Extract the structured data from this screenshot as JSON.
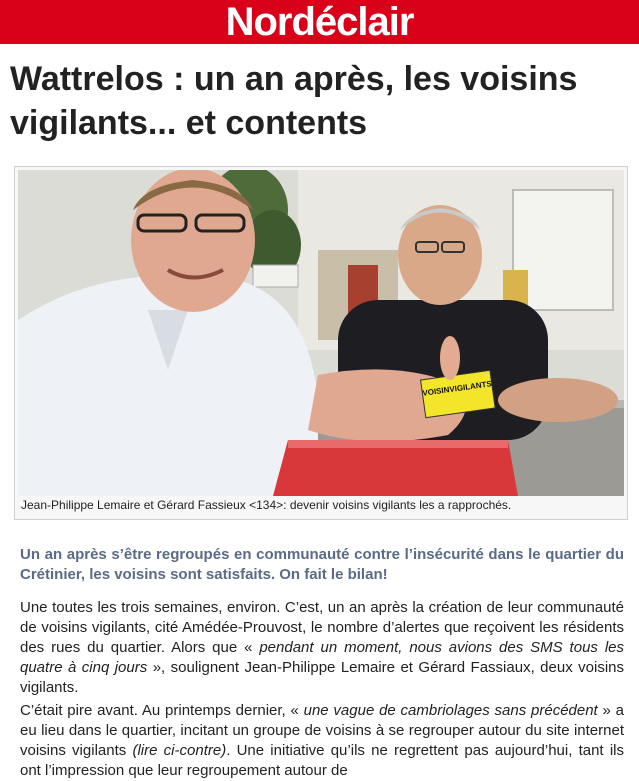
{
  "brand": {
    "logo": "Nordéclair"
  },
  "article": {
    "title": "Wattrelos : un an après, les voisins vigilants... et contents",
    "photo_caption": "Jean-Philippe Lemaire et Gérard Fassieux <134>: devenir voisins vigilants les a rapprochés.",
    "photo_card_text": "VOISINVIGILANTS",
    "lede": "Un an après s’être regroupés en communauté contre l’insécurité dans le quartier du Crétinier, les voisins sont satisfaits. On fait le bilan!",
    "p1": {
      "a": "Une toutes les trois semaines, environ. C’est, un an après la création de leur communauté de voisins vigilants, cité Amédée-Prouvost, le nombre d’alertes que reçoivent les résidents des rues du quartier. Alors que « ",
      "quote": "pendant un moment, nous avions des SMS tous les quatre à cinq jours",
      "b": " », soulignent Jean-Philippe Lemaire et Gérard Fassiaux, deux voisins vigilants."
    },
    "p2": {
      "a": "C’était pire avant. Au printemps dernier, « ",
      "quote": "une vague de cambriolages sans précédent",
      "b": " » a eu lieu dans le quartier, incitant un groupe de voisins à se regrouper autour du site internet voisins vigilants ",
      "ref": "(lire ci-contre)",
      "c": ". Une initiative qu’ils ne regrettent pas aujourd’hui, tant ils ont l’impression que leur regroupement autour de"
    }
  }
}
